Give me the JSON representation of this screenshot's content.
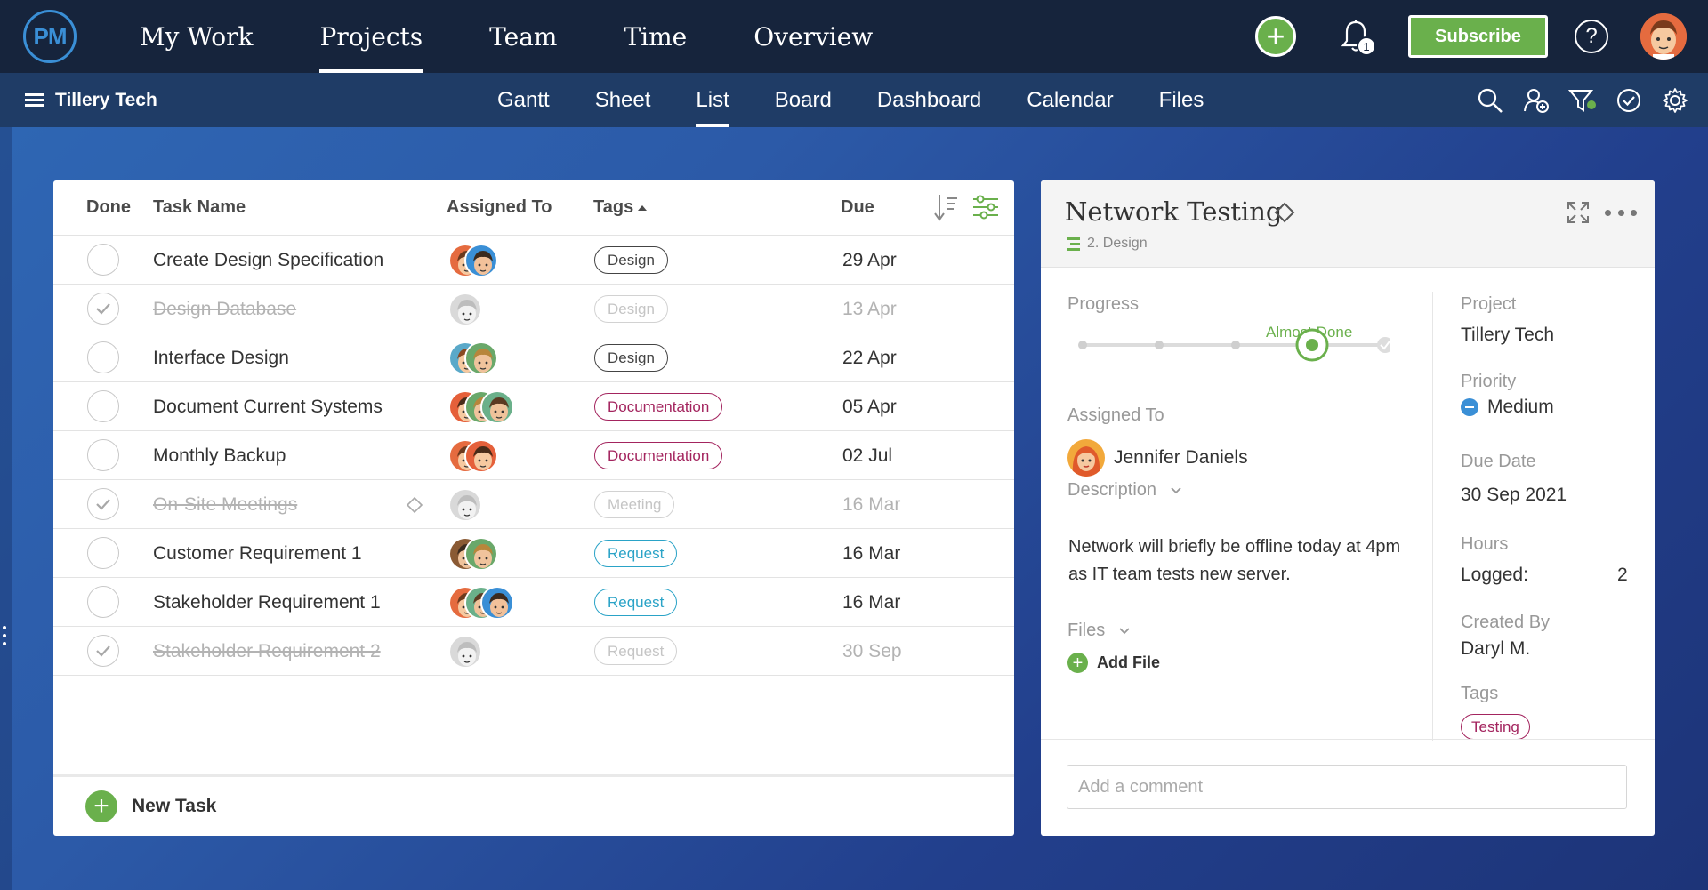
{
  "topnav": {
    "logo_text": "PM",
    "items": [
      {
        "label": "My Work",
        "active": false
      },
      {
        "label": "Projects",
        "active": true
      },
      {
        "label": "Team",
        "active": false
      },
      {
        "label": "Time",
        "active": false
      },
      {
        "label": "Overview",
        "active": false
      }
    ],
    "notification_count": "1",
    "subscribe_label": "Subscribe",
    "help_label": "?"
  },
  "subnav": {
    "project_name": "Tillery Tech",
    "views": [
      {
        "label": "Gantt",
        "active": false
      },
      {
        "label": "Sheet",
        "active": false
      },
      {
        "label": "List",
        "active": true
      },
      {
        "label": "Board",
        "active": false
      },
      {
        "label": "Dashboard",
        "active": false
      },
      {
        "label": "Calendar",
        "active": false
      },
      {
        "label": "Files",
        "active": false
      }
    ],
    "icons": [
      "search-icon",
      "add-user-icon",
      "filter-icon",
      "check-circle-icon",
      "gear-icon"
    ]
  },
  "tasklist": {
    "headers": {
      "done": "Done",
      "task": "Task Name",
      "assigned": "Assigned To",
      "tags": "Tags",
      "due": "Due"
    },
    "tags_sorted": "ascending",
    "rows": [
      {
        "name": "Create Design Specification",
        "done": false,
        "avatars": [
          "orange-man",
          "blue-man"
        ],
        "tag": "Design",
        "tag_kind": "design",
        "due": "29 Apr"
      },
      {
        "name": "Design Database",
        "done": true,
        "avatars": [
          "gray"
        ],
        "tag": "Design",
        "tag_kind": "design",
        "due": "13 Apr"
      },
      {
        "name": "Interface Design",
        "done": false,
        "avatars": [
          "teal-glasses",
          "green-man"
        ],
        "tag": "Design",
        "tag_kind": "design",
        "due": "22 Apr"
      },
      {
        "name": "Document Current Systems",
        "done": false,
        "avatars": [
          "orange-woman",
          "green-man",
          "green-woman"
        ],
        "tag": "Documentation",
        "tag_kind": "doc",
        "due": "05 Apr"
      },
      {
        "name": "Monthly Backup",
        "done": false,
        "avatars": [
          "orange-man",
          "orange-woman"
        ],
        "tag": "Documentation",
        "tag_kind": "doc",
        "due": "02 Jul"
      },
      {
        "name": "On-Site Meetings",
        "done": true,
        "avatars": [
          "gray"
        ],
        "tag": "Meeting",
        "tag_kind": "meeting",
        "due": "16 Mar",
        "milestone": true
      },
      {
        "name": "Customer Requirement 1",
        "done": false,
        "avatars": [
          "brown-glasses",
          "green-man"
        ],
        "tag": "Request",
        "tag_kind": "req",
        "due": "16 Mar"
      },
      {
        "name": "Stakeholder Requirement 1",
        "done": false,
        "avatars": [
          "orange-man",
          "green-woman",
          "blue-man"
        ],
        "tag": "Request",
        "tag_kind": "req",
        "due": "16 Mar"
      },
      {
        "name": "Stakeholder Requirement 2",
        "done": true,
        "avatars": [
          "gray"
        ],
        "tag": "Request",
        "tag_kind": "req",
        "due": "30 Sep"
      }
    ],
    "new_task_label": "New Task"
  },
  "detail": {
    "title": "Network Testing",
    "parent": "2. Design",
    "progress_label": "Progress",
    "progress_state": "Almost Done",
    "progress_step": 4,
    "progress_steps_total": 5,
    "assigned_label": "Assigned To",
    "assignee": "Jennifer Daniels",
    "description_label": "Description",
    "description": "Network will briefly be offline today at 4pm as IT team tests new server.",
    "files_label": "Files",
    "add_file_label": "Add File",
    "project_label": "Project",
    "project": "Tillery Tech",
    "priority_label": "Priority",
    "priority": "Medium",
    "due_label": "Due Date",
    "due": "30 Sep 2021",
    "hours_label": "Hours",
    "hours_logged_label": "Logged:",
    "hours_logged": "2",
    "created_label": "Created By",
    "created_by": "Daryl M.",
    "tags_label": "Tags",
    "tag": "Testing",
    "comment_placeholder": "Add a comment"
  },
  "colors": {
    "topbar": "#16243c",
    "subbar": "#1f3c66",
    "accent_green": "#6ab04c",
    "doc_tag": "#a3245e",
    "req_tag": "#2aa3c7",
    "priority_medium": "#3a8fd6"
  }
}
